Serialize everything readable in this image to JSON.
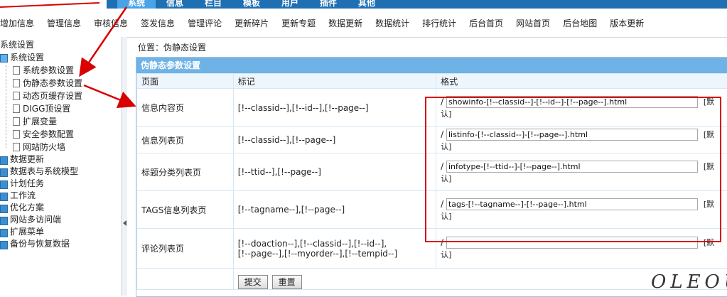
{
  "top_nav": {
    "items": [
      "系统",
      "信息",
      "栏目",
      "模板",
      "用户",
      "插件",
      "其他"
    ],
    "active_index": 0
  },
  "sub_nav": [
    "增加信息",
    "管理信息",
    "审核信息",
    "签发信息",
    "管理评论",
    "更新碎片",
    "更新专题",
    "数据更新",
    "数据统计",
    "排行统计",
    "后台首页",
    "网站首页",
    "后台地图",
    "版本更新"
  ],
  "sidebar": {
    "title": "系统设置",
    "group": "系统设置",
    "children": [
      "系统参数设置",
      "伪静态参数设置",
      "动态页缓存设置",
      "DIGG顶设置",
      "扩展变量",
      "安全参数配置",
      "网站防火墙"
    ],
    "folders": [
      "数据更新",
      "数据表与系统模型",
      "计划任务",
      "工作流",
      "优化方案",
      "网站多访问端",
      "扩展菜单",
      "备份与恢复数据"
    ]
  },
  "breadcrumb": "位置：伪静态设置",
  "panel": {
    "title": "伪静态参数设置",
    "headers": [
      "页面",
      "标记",
      "格式"
    ],
    "rows": [
      {
        "page": "信息内容页",
        "tags": "[!--classid--],[!--id--],[!--page--]",
        "prefix": "/",
        "format": "showinfo-[!--classid--]-[!--id--]-[!--page--].html",
        "default": "[默认]"
      },
      {
        "page": "信息列表页",
        "tags": "[!--classid--],[!--page--]",
        "prefix": "/",
        "format": "listinfo-[!--classid--]-[!--page--].html",
        "default": "[默认]"
      },
      {
        "page": "标题分类列表页",
        "tags": "[!--ttid--],[!--page--]",
        "prefix": "/",
        "format": "infotype-[!--ttid--]-[!--page--].html",
        "default": "[默认]"
      },
      {
        "page": "TAGS信息列表页",
        "tags": "[!--tagname--],[!--page--]",
        "prefix": "/",
        "format": "tags-[!--tagname--]-[!--page--].html",
        "default": "[默认]"
      },
      {
        "page": "评论列表页",
        "tags_line1": "[!--doaction--],[!--classid--],[!--id--],",
        "tags_line2": "[!--page--],[!--myorder--],[!--tempid--]",
        "prefix": "/",
        "format": "",
        "default": "[默认]"
      }
    ],
    "submit_label": "提交",
    "reset_label": "重置"
  },
  "watermark": "OLEOU",
  "colors": {
    "topbar": "#1f6fb3",
    "active_tab": "#4aa3e6",
    "panel_title": "#6fb2e6",
    "annotation": "#d80000"
  }
}
